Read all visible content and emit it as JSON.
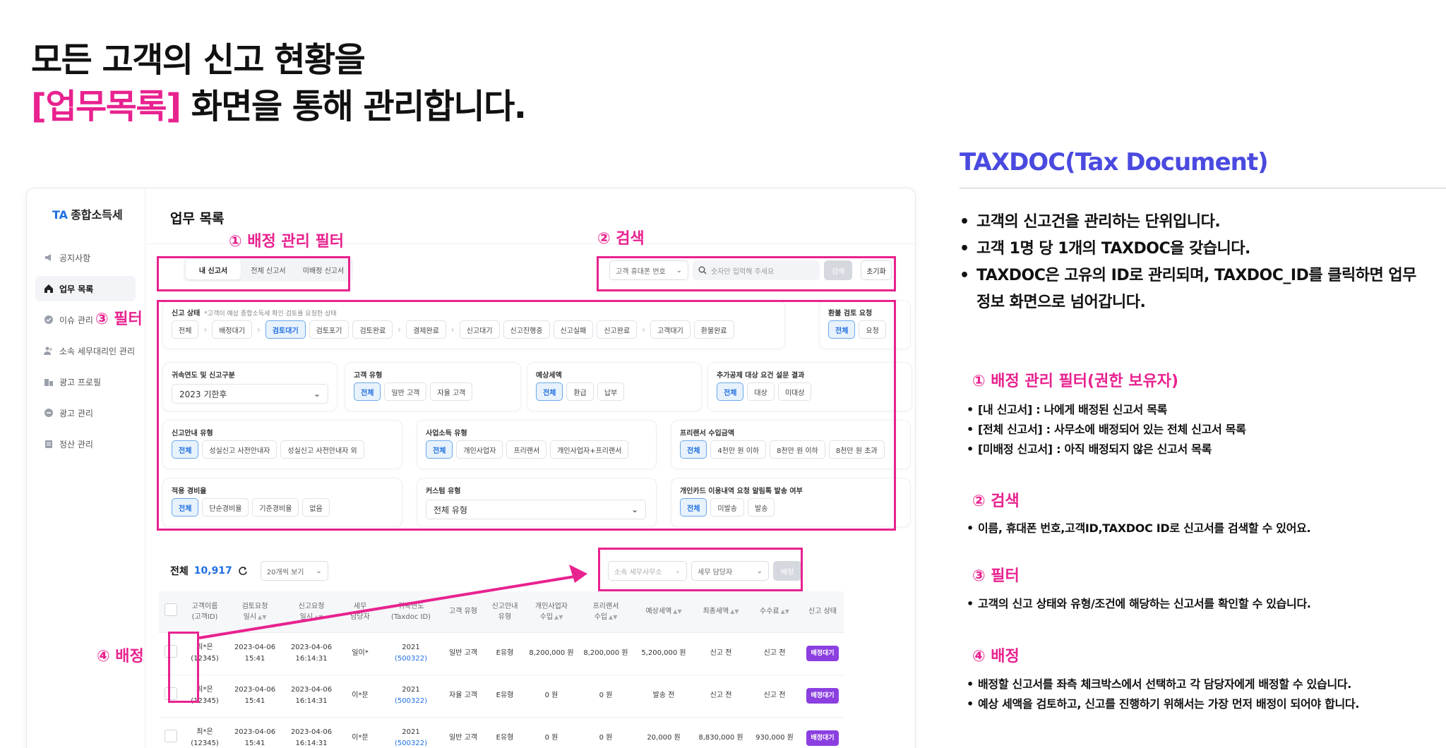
{
  "headline": {
    "line1": "모든 고객의 신고 현황을",
    "line2_highlight": "[업무목록]",
    "line2_rest": " 화면을 통해 관리합니다.",
    "highlight_color": "#e8228f"
  },
  "app": {
    "logo_mark": "TA",
    "logo_text": "종합소득세",
    "nav": [
      {
        "label": "공지사항",
        "icon": "megaphone-icon"
      },
      {
        "label": "업무 목록",
        "icon": "home-icon"
      },
      {
        "label": "이슈 관리",
        "icon": "check-circle-icon"
      },
      {
        "label": "소속 세무대리인 관리",
        "icon": "users-icon"
      },
      {
        "label": "광고 프로필",
        "icon": "building-icon"
      },
      {
        "label": "광고 관리",
        "icon": "minus-circle-icon"
      },
      {
        "label": "정산 관리",
        "icon": "clipboard-icon"
      }
    ],
    "page_title": "업무 목록",
    "tabs": [
      "내 신고서",
      "전체 신고서",
      "미배정 신고서"
    ],
    "search": {
      "select_value": "고객 휴대폰 번호",
      "placeholder": "숫자만 입력해 주세요",
      "search_label": "검색",
      "reset_label": "초기화"
    },
    "filters": {
      "status": {
        "title": "신고 상태",
        "note": "*고객이 예상 종합소득세 확인 검토를 요청한 상태",
        "groups": [
          [
            "전체"
          ],
          [
            "배정대기"
          ],
          [
            "검토대기",
            "검토포기",
            "검토완료"
          ],
          [
            "결제완료"
          ],
          [
            "신고대기",
            "신고진행중",
            "신고실패",
            "신고완료"
          ],
          [
            "고객대기",
            "환불완료"
          ]
        ],
        "selected": "검토대기"
      },
      "refund": {
        "title": "환불 검토 요청",
        "options": [
          "전체",
          "요청"
        ],
        "selected": "전체"
      },
      "year": {
        "title": "귀속연도 및 신고구분",
        "value": "2023 기한후"
      },
      "customer_type": {
        "title": "고객 유형",
        "options": [
          "전체",
          "일반 고객",
          "자율 고객"
        ],
        "selected": "전체"
      },
      "expected_tax": {
        "title": "예상세액",
        "options": [
          "전체",
          "환급",
          "납부"
        ],
        "selected": "전체"
      },
      "extra_deduction": {
        "title": "추가공제 대상 요건 설문 결과",
        "options": [
          "전체",
          "대상",
          "미대상"
        ],
        "selected": "전체"
      },
      "guide_type": {
        "title": "신고안내 유형",
        "options": [
          "전체",
          "성실신고 사전안내자",
          "성실신고 사전안내자 외"
        ],
        "selected": "전체"
      },
      "business_type": {
        "title": "사업소득 유형",
        "options": [
          "전체",
          "개인사업자",
          "프리랜서",
          "개인사업자+프리랜서"
        ],
        "selected": "전체"
      },
      "freelancer_income": {
        "title": "프리랜서 수입금액",
        "options": [
          "전체",
          "4천만 원 이하",
          "8천만 원 이하",
          "8천만 원 초과"
        ],
        "selected": "전체"
      },
      "expense_rate": {
        "title": "적용 경비율",
        "options": [
          "전체",
          "단순경비율",
          "기준경비율",
          "없음"
        ],
        "selected": "전체"
      },
      "custom_type": {
        "title": "커스텀 유형",
        "value": "전체 유형"
      },
      "card_alert": {
        "title": "개인카드 이용내역 요청 알림톡 발송 여부",
        "options": [
          "전체",
          "미발송",
          "발송"
        ],
        "selected": "전체"
      }
    },
    "total": {
      "label": "전체",
      "count": "10,917",
      "page_size": "20개씩 보기"
    },
    "assign": {
      "office_placeholder": "소속 세무사무소",
      "manager_placeholder": "세무 담당자",
      "button": "배정"
    },
    "table": {
      "headers": [
        "고객이름\n(고객ID)",
        "검토요청\n일시",
        "신고요청\n일시",
        "세무\n담당자",
        "귀속연도\n(Taxdoc ID)",
        "고객 유형",
        "신고안내\n유형",
        "개인사업자\n수입",
        "프리랜서\n수입",
        "예상세액",
        "최종세액",
        "수수료",
        "신고 상태"
      ],
      "rows": [
        {
          "name": "최*은",
          "id": "(12345)",
          "review_date": "2023-04-06",
          "review_time": "15:41",
          "report_date": "2023-04-06",
          "report_time": "16:14:31",
          "manager": "일이*",
          "year": "2021",
          "taxdoc": "(500322)",
          "ctype": "일반 고객",
          "guide": "E유형",
          "biz": "8,200,000 원",
          "free": "8,200,000 원",
          "expected": "5,200,000 원",
          "final": "신고 전",
          "fee": "신고 전",
          "status": "배정대기"
        },
        {
          "name": "최*은",
          "id": "(12345)",
          "review_date": "2023-04-06",
          "review_time": "15:41",
          "report_date": "2023-04-06",
          "report_time": "16:14:31",
          "manager": "이*문",
          "year": "2021",
          "taxdoc": "(500322)",
          "ctype": "자율 고객",
          "guide": "E유형",
          "biz": "0 원",
          "free": "0 원",
          "expected": "발송 전",
          "final": "신고 전",
          "fee": "신고 전",
          "status": "배정대기"
        },
        {
          "name": "최*은",
          "id": "(12345)",
          "review_date": "2023-04-06",
          "review_time": "15:41",
          "report_date": "2023-04-06",
          "report_time": "16:14:31",
          "manager": "이*문",
          "year": "2021",
          "taxdoc": "(500322)",
          "ctype": "일반 고객",
          "guide": "E유형",
          "biz": "0 원",
          "free": "0 원",
          "expected": "20,000 원",
          "final": "8,830,000 원",
          "fee": "930,000 원",
          "status": "배정대기"
        }
      ]
    }
  },
  "annotations": {
    "assign_filter": "① 배정 관리 필터",
    "search": "② 검색",
    "filter": "③ 필터",
    "assign": "④ 배정"
  },
  "panel": {
    "title": "TAXDOC(Tax Document)",
    "title_color": "#4a4ae0",
    "bullets": [
      "고객의 신고건을 관리하는 단위입니다.",
      "고객 1명 당 1개의 TAXDOC을 갖습니다.",
      "TAXDOC은 고유의 ID로 관리되며, TAXDOC_ID를 클릭하면 업무 정보 화면으로 넘어갑니다."
    ],
    "sections": [
      {
        "title": "① 배정 관리 필터(권한 보유자)",
        "items": [
          "[내 신고서] : 나에게 배정된 신고서 목록",
          "[전체 신고서] : 사무소에 배정되어 있는 전체 신고서 목록",
          "[미배정 신고서] : 아직 배정되지 않은 신고서 목록"
        ]
      },
      {
        "title": "② 검색",
        "items": [
          "이름, 휴대폰 번호,고객ID,TAXDOC ID로 신고서를 검색할 수 있어요."
        ]
      },
      {
        "title": "③ 필터",
        "items": [
          "고객의 신고 상태와 유형/조건에 해당하는 신고서를 확인할 수 있습니다."
        ]
      },
      {
        "title": "④ 배정",
        "items": [
          "배정할 신고서를 좌측 체크박스에서 선택하고 각 담당자에게 배정할 수 있습니다.",
          "예상 세액을 검토하고, 신고를 진행하기 위해서는 가장 먼저 배정이 되어야 합니다."
        ]
      }
    ]
  }
}
